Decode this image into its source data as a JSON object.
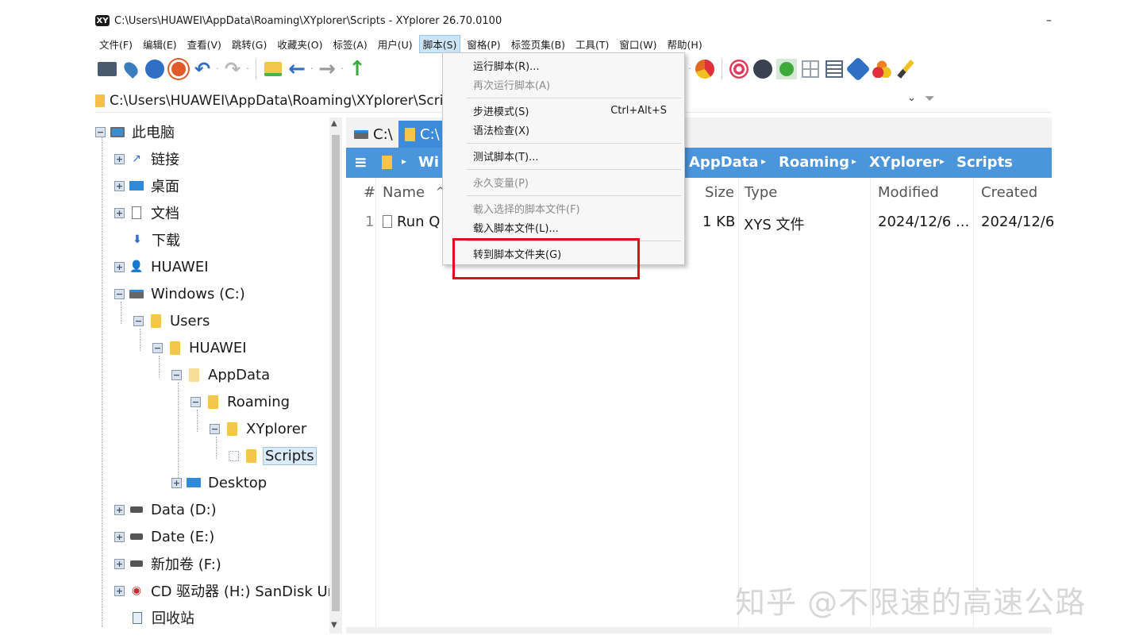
{
  "window": {
    "title": "C:\\Users\\HUAWEI\\AppData\\Roaming\\XYplorer\\Scripts - XYplorer 26.70.0100",
    "minimize": "–"
  },
  "menubar": [
    "文件(F)",
    "编辑(E)",
    "查看(V)",
    "跳转(G)",
    "收藏夹(O)",
    "标签(A)",
    "用户(U)",
    "脚本(S)",
    "窗格(P)",
    "标签页集(B)",
    "工具(T)",
    "窗口(W)",
    "帮助(H)"
  ],
  "address": {
    "path": "C:\\Users\\HUAWEI\\AppData\\Roaming\\XYplorer\\Scripts",
    "dropdown_icon": "⌄",
    "filter_icon": "⏷"
  },
  "tree": {
    "items": [
      "此电脑",
      "链接",
      "桌面",
      "文档",
      "下载",
      "HUAWEI",
      "Windows (C:)",
      "Users",
      "HUAWEI",
      "AppData",
      "Roaming",
      "XYplorer",
      "Scripts",
      "Desktop",
      "Data (D:)",
      "Date (E:)",
      "新加卷 (F:)",
      "CD 驱动器 (H:) SanDisk Ur",
      "回收站"
    ]
  },
  "tabs": [
    "C:\\",
    "C:\\"
  ],
  "breadcrumb": {
    "items": [
      "Wi",
      "AppData",
      "Roaming",
      "XYplorer",
      "Scripts"
    ]
  },
  "columns": [
    "#",
    "Name",
    "^",
    "Size",
    "Type",
    "Modified",
    "Created"
  ],
  "files": [
    {
      "num": "1",
      "name": "Run Q",
      "size": "1 KB",
      "type": "XYS 文件",
      "modified": "2024/12/6 ...",
      "created": "2024/12/6"
    }
  ],
  "script_menu": {
    "items": [
      {
        "label": "运行脚本(R)...",
        "shortcut": "",
        "disabled": false
      },
      {
        "label": "再次运行脚本(A)",
        "shortcut": "",
        "disabled": true
      },
      {
        "label": "步进模式(S)",
        "shortcut": "Ctrl+Alt+S",
        "disabled": false
      },
      {
        "label": "语法检查(X)",
        "shortcut": "",
        "disabled": false
      },
      {
        "label": "测试脚本(T)...",
        "shortcut": "",
        "disabled": false
      },
      {
        "label": "永久变量(P)",
        "shortcut": "",
        "disabled": true
      },
      {
        "label": "载入选择的脚本文件(F)",
        "shortcut": "",
        "disabled": true
      },
      {
        "label": "载入脚本文件(L)...",
        "shortcut": "",
        "disabled": false
      },
      {
        "label": "转到脚本文件夹(G)",
        "shortcut": "",
        "disabled": false
      }
    ],
    "highlight_color": "#e0101a"
  },
  "watermark": "知乎 @不限速的高速公路",
  "colors": {
    "accent": "#3d8bd9",
    "breadcrumb_bg": "#4a95dc",
    "folder": "#f6c64c"
  }
}
